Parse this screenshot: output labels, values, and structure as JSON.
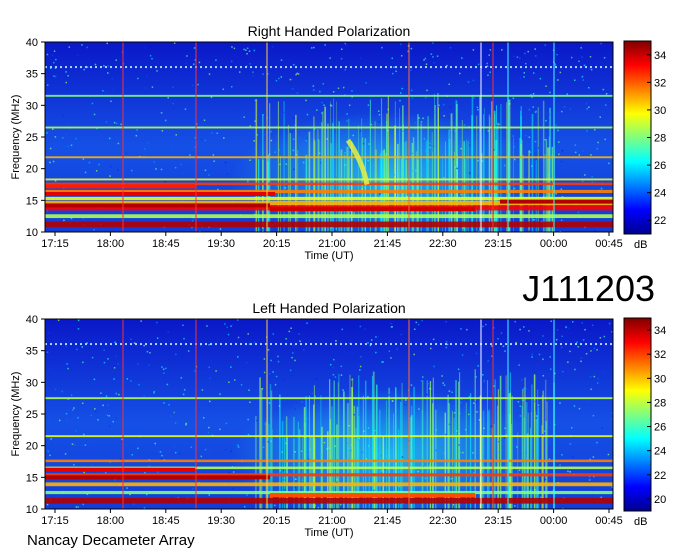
{
  "figure": {
    "observation_id": "J111203",
    "footer": "Nancay Decameter Array"
  },
  "chart_data": [
    {
      "type": "heatmap",
      "title": "Right Handed Polarization",
      "xlabel": "Time (UT)",
      "ylabel": "Frequency (MHz)",
      "x_ticks": [
        "17:15",
        "18:00",
        "18:45",
        "19:30",
        "20:15",
        "21:00",
        "21:45",
        "22:30",
        "23:15",
        "00:00",
        "00:45"
      ],
      "y_ticks": [
        10,
        15,
        20,
        25,
        30,
        35,
        40
      ],
      "ylim": [
        10,
        40
      ],
      "colorbar": {
        "label": "dB",
        "range": [
          21,
          35
        ],
        "ticks": [
          22,
          24,
          26,
          28,
          30,
          32,
          34
        ]
      }
    },
    {
      "type": "heatmap",
      "title": "Left Handed Polarization",
      "xlabel": "Time (UT)",
      "ylabel": "Frequency (MHz)",
      "x_ticks": [
        "17:15",
        "18:00",
        "18:45",
        "19:30",
        "20:15",
        "21:00",
        "21:45",
        "22:30",
        "23:15",
        "00:00",
        "00:45"
      ],
      "y_ticks": [
        10,
        15,
        20,
        25,
        30,
        35,
        40
      ],
      "ylim": [
        10,
        40
      ],
      "colorbar": {
        "label": "dB",
        "range": [
          19,
          35
        ],
        "ticks": [
          20,
          22,
          24,
          26,
          28,
          30,
          32,
          34
        ]
      }
    }
  ]
}
